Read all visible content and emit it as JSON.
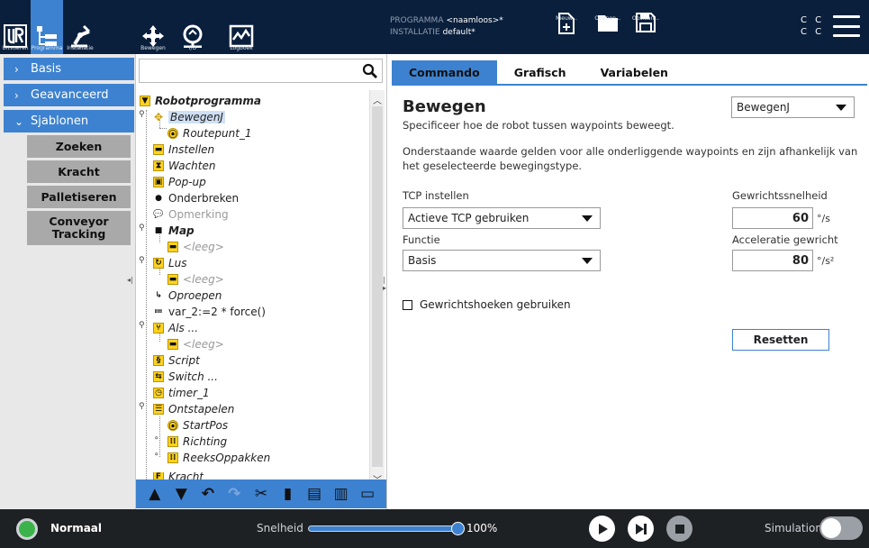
{
  "header": {
    "nav_buttons": [
      {
        "label": "Uitvoeren",
        "icon": "ur-logo-icon"
      },
      {
        "label": "Programma",
        "icon": "program-tree-icon"
      },
      {
        "label": "Installatie",
        "icon": "robot-arm-icon"
      },
      {
        "label": "Bewegen",
        "icon": "move-arrows-icon"
      },
      {
        "label": "I/O",
        "icon": "io-icon"
      },
      {
        "label": "Logboek",
        "icon": "log-chart-icon"
      }
    ],
    "program_key": "PROGRAMMA",
    "program_value": "<naamloos>*",
    "installation_key": "INSTALLATIE",
    "installation_value": "default*",
    "file_buttons": {
      "new": "Nieuw...",
      "open": "Openen...",
      "save": "Opslaan..."
    },
    "cc_line1": "C C",
    "cc_line2": "C C"
  },
  "leftnav": {
    "sections": [
      {
        "label": "Basis",
        "chevron": "›"
      },
      {
        "label": "Geavanceerd",
        "chevron": "›"
      },
      {
        "label": "Sjablonen",
        "chevron": "⌄"
      }
    ],
    "templates": [
      "Zoeken",
      "Kracht",
      "Palletiseren",
      "Conveyor Tracking"
    ]
  },
  "tree": {
    "search_placeholder": "",
    "items": [
      {
        "label": "Robotprogramma",
        "icon": "flag"
      },
      {
        "label": "BewegenJ",
        "icon": "move"
      },
      {
        "label": "Routepunt_1",
        "icon": "waypoint"
      },
      {
        "label": "Instellen",
        "icon": "set"
      },
      {
        "label": "Wachten",
        "icon": "wait"
      },
      {
        "label": "Pop-up",
        "icon": "popup"
      },
      {
        "label": "Onderbreken",
        "icon": "halt"
      },
      {
        "label": "Opmerking",
        "icon": "comment"
      },
      {
        "label": "Map",
        "icon": "folder"
      },
      {
        "label": "<leeg>",
        "icon": "empty"
      },
      {
        "label": "Lus",
        "icon": "loop"
      },
      {
        "label": "<leeg>",
        "icon": "empty"
      },
      {
        "label": "Oproepen",
        "icon": "call"
      },
      {
        "label": "var_2:=2 * force()",
        "icon": "assign"
      },
      {
        "label": "Als ...",
        "icon": "if"
      },
      {
        "label": "<leeg>",
        "icon": "empty"
      },
      {
        "label": "Script",
        "icon": "script"
      },
      {
        "label": "Switch ...",
        "icon": "switch"
      },
      {
        "label": "timer_1",
        "icon": "timer"
      },
      {
        "label": "Ontstapelen",
        "icon": "destack"
      },
      {
        "label": "StartPos",
        "icon": "waypoint"
      },
      {
        "label": "Richting",
        "icon": "grid"
      },
      {
        "label": "ReeksOppakken",
        "icon": "grid"
      },
      {
        "label": "Kracht",
        "icon": "force"
      }
    ]
  },
  "toolbar": [
    "move-up",
    "move-down",
    "undo",
    "redo",
    "cut",
    "copy",
    "paste",
    "delete",
    "suppress"
  ],
  "tabs": [
    "Commando",
    "Grafisch",
    "Variabelen"
  ],
  "command": {
    "title": "Bewegen",
    "description": "Specificeer hoe de robot tussen waypoints beweegt.",
    "description2": "Onderstaande waarde gelden voor alle onderliggende waypoints en zijn afhankelijk van het geselecteerde bewegingstype.",
    "move_type": "BewegenJ",
    "tcp_label": "TCP instellen",
    "tcp_value": "Actieve TCP gebruiken",
    "function_label": "Functie",
    "function_value": "Basis",
    "joint_speed_label": "Gewrichtssnelheid",
    "joint_speed_value": "60",
    "joint_speed_unit": "°/s",
    "joint_accel_label": "Acceleratie gewricht",
    "joint_accel_value": "80",
    "joint_accel_unit": "°/s²",
    "joint_angles_label": "Gewrichtshoeken gebruiken",
    "reset_label": "Resetten"
  },
  "footer": {
    "status": "Normaal",
    "speed_label": "Snelheid",
    "speed_value": "100%",
    "speed_fraction": 1.0,
    "simulation_label": "Simulation",
    "colors": {
      "status": "#3bb34a",
      "accent": "#3d82d0"
    }
  }
}
